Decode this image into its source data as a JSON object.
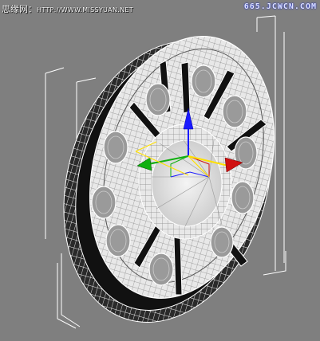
{
  "watermark": {
    "site_name": "思缘网：",
    "site_url": "HTTP://WWW.MISSYUAN.NET",
    "right_mark": "665.JCWCN.COM"
  },
  "colors": {
    "viewport_bg": "#7f7f7f",
    "wire": "#ffffff",
    "gizmo_z": "#1a1aff",
    "gizmo_x": "#d01010",
    "gizmo_y": "#10b010",
    "pivot": "#ffe000"
  },
  "icons": [
    "wheel-mesh",
    "transform-gizmo",
    "selection-bracket"
  ]
}
